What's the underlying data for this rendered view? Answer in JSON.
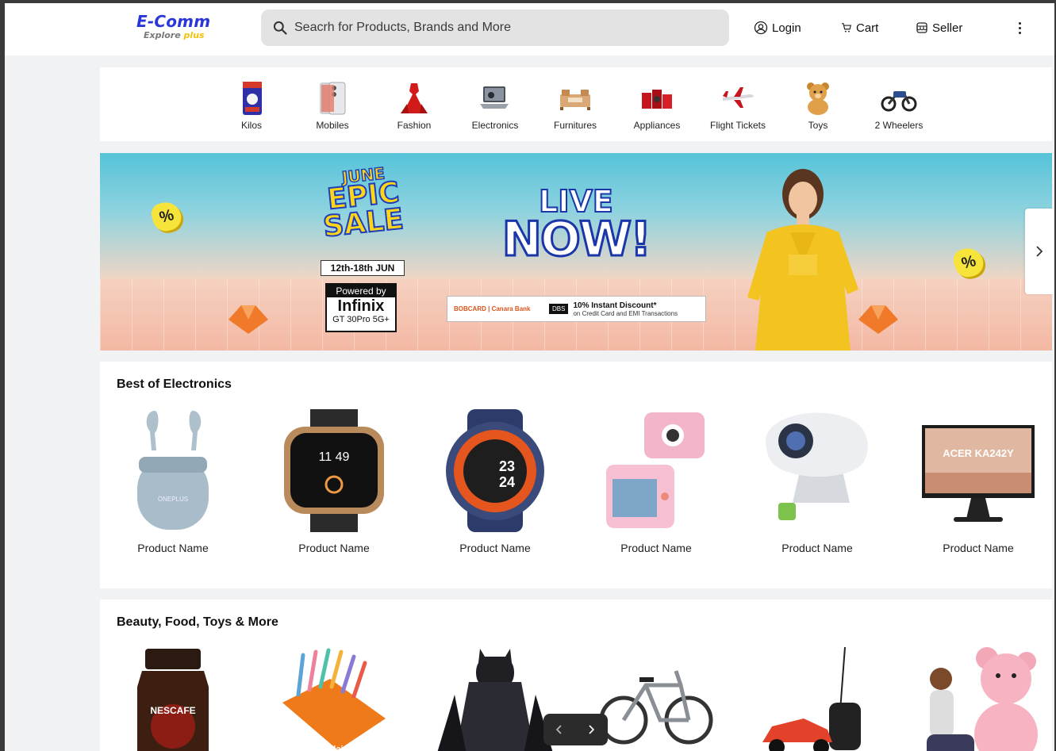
{
  "header": {
    "logo_main": "E-Comm",
    "logo_sub": "Explore",
    "logo_sub_accent": "plus",
    "search_placeholder": "Seacrh for Products, Brands and More",
    "login_label": "Login",
    "cart_label": "Cart",
    "seller_label": "Seller"
  },
  "categories": [
    {
      "label": "Kilos",
      "icon": "grocery-pack-icon"
    },
    {
      "label": "Mobiles",
      "icon": "mobile-phone-icon"
    },
    {
      "label": "Fashion",
      "icon": "dress-icon"
    },
    {
      "label": "Electronics",
      "icon": "laptop-icon"
    },
    {
      "label": "Furnitures",
      "icon": "furniture-icon"
    },
    {
      "label": "Appliances",
      "icon": "appliance-icon"
    },
    {
      "label": "Flight Tickets",
      "icon": "airplane-icon"
    },
    {
      "label": "Toys",
      "icon": "teddy-bear-icon"
    },
    {
      "label": "2 Wheelers",
      "icon": "motorbike-icon"
    }
  ],
  "banner": {
    "june": "JUNE",
    "epic": "EPIC",
    "sale": "SALE",
    "dates": "12th-18th JUN",
    "powered_by": "Powered by",
    "brand": "Infinix",
    "model": "GT 30Pro 5G+",
    "live_1": "LIVE",
    "live_2": "NOW!",
    "bank_1": "BOBCARD",
    "bank_2": "Canara Bank",
    "bank_3": "DBS",
    "offer_title": "10% Instant Discount*",
    "offer_sub": "on Credit Card and EMI Transactions"
  },
  "sections": {
    "electronics": {
      "title": "Best of Electronics",
      "products": [
        {
          "name": "Product Name",
          "icon": "earbuds-icon"
        },
        {
          "name": "Product Name",
          "icon": "smartwatch-square-icon"
        },
        {
          "name": "Product Name",
          "icon": "smartwatch-round-icon"
        },
        {
          "name": "Product Name",
          "icon": "kids-camera-icon"
        },
        {
          "name": "Product Name",
          "icon": "projector-icon"
        },
        {
          "name": "Product Name",
          "icon": "monitor-icon"
        }
      ],
      "monitor_text": "ACER KA242Y"
    },
    "beauty": {
      "title": "Beauty, Food, Toys & More",
      "products": [
        {
          "icon": "coffee-jar-icon"
        },
        {
          "icon": "pens-box-icon"
        },
        {
          "icon": "action-figure-icon"
        },
        {
          "icon": "bicycle-icon"
        },
        {
          "icon": "rc-car-icon"
        },
        {
          "icon": "teddy-bear-large-icon"
        }
      ],
      "coffee_text": "NESCAFE",
      "pens_text": "Flair SRX"
    }
  },
  "colors": {
    "brand_blue": "#2b36d9",
    "brand_yellow": "#f2c20c",
    "search_bg": "#e3e3e3",
    "page_bg": "#f1f2f4"
  }
}
